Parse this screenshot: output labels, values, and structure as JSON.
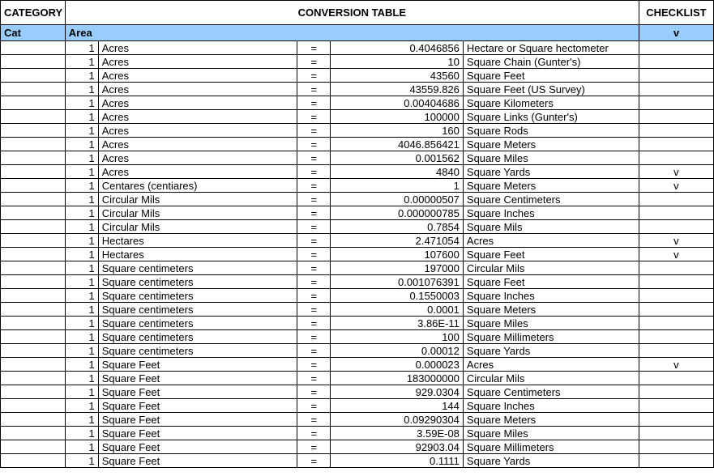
{
  "headers": {
    "category": "CATEGORY",
    "conversion_table": "CONVERSION TABLE",
    "checklist": "CHECKLIST",
    "cat": "Cat",
    "area": "Area",
    "v": "v"
  },
  "rows": [
    {
      "qty": "1",
      "unit": "Acres",
      "eq": "=",
      "val": "0.4046856",
      "result": "Hectare or Square hectometer",
      "check": ""
    },
    {
      "qty": "1",
      "unit": "Acres",
      "eq": "=",
      "val": "10",
      "result": "Square Chain (Gunter's)",
      "check": ""
    },
    {
      "qty": "1",
      "unit": "Acres",
      "eq": "=",
      "val": "43560",
      "result": "Square Feet",
      "check": ""
    },
    {
      "qty": "1",
      "unit": "Acres",
      "eq": "=",
      "val": "43559.826",
      "result": "Square Feet (US Survey)",
      "check": ""
    },
    {
      "qty": "1",
      "unit": "Acres",
      "eq": "=",
      "val": "0.00404686",
      "result": "Square Kilometers",
      "check": ""
    },
    {
      "qty": "1",
      "unit": "Acres",
      "eq": "=",
      "val": "100000",
      "result": "Square Links (Gunter's)",
      "check": ""
    },
    {
      "qty": "1",
      "unit": "Acres",
      "eq": "=",
      "val": "160",
      "result": "Square Rods",
      "check": ""
    },
    {
      "qty": "1",
      "unit": "Acres",
      "eq": "=",
      "val": "4046.856421",
      "result": "Square Meters",
      "check": ""
    },
    {
      "qty": "1",
      "unit": "Acres",
      "eq": "=",
      "val": "0.001562",
      "result": "Square Miles",
      "check": ""
    },
    {
      "qty": "1",
      "unit": "Acres",
      "eq": "=",
      "val": "4840",
      "result": "Square Yards",
      "check": "v"
    },
    {
      "qty": "1",
      "unit": "Centares (centiares)",
      "eq": "=",
      "val": "1",
      "result": "Square Meters",
      "check": "v"
    },
    {
      "qty": "1",
      "unit": "Circular Mils",
      "eq": "=",
      "val": "0.00000507",
      "result": "Square Centimeters",
      "check": ""
    },
    {
      "qty": "1",
      "unit": "Circular Mils",
      "eq": "=",
      "val": "0.000000785",
      "result": "Square Inches",
      "check": ""
    },
    {
      "qty": "1",
      "unit": "Circular Mils",
      "eq": "=",
      "val": "0.7854",
      "result": "Square Mils",
      "check": ""
    },
    {
      "qty": "1",
      "unit": "Hectares",
      "eq": "=",
      "val": "2.471054",
      "result": "Acres",
      "check": "v"
    },
    {
      "qty": "1",
      "unit": "Hectares",
      "eq": "=",
      "val": "107600",
      "result": "Square Feet",
      "check": "v"
    },
    {
      "qty": "1",
      "unit": "Square centimeters",
      "eq": "=",
      "val": "197000",
      "result": "Circular Mils",
      "check": ""
    },
    {
      "qty": "1",
      "unit": "Square centimeters",
      "eq": "=",
      "val": "0.001076391",
      "result": "Square Feet",
      "check": ""
    },
    {
      "qty": "1",
      "unit": "Square centimeters",
      "eq": "=",
      "val": "0.1550003",
      "result": "Square Inches",
      "check": ""
    },
    {
      "qty": "1",
      "unit": "Square centimeters",
      "eq": "=",
      "val": "0.0001",
      "result": "Square Meters",
      "check": ""
    },
    {
      "qty": "1",
      "unit": "Square centimeters",
      "eq": "=",
      "val": "3.86E-11",
      "result": "Square Miles",
      "check": ""
    },
    {
      "qty": "1",
      "unit": "Square centimeters",
      "eq": "=",
      "val": "100",
      "result": "Square Millimeters",
      "check": ""
    },
    {
      "qty": "1",
      "unit": "Square centimeters",
      "eq": "=",
      "val": "0.00012",
      "result": "Square Yards",
      "check": ""
    },
    {
      "qty": "1",
      "unit": "Square Feet",
      "eq": "=",
      "val": "0.000023",
      "result": "Acres",
      "check": "v"
    },
    {
      "qty": "1",
      "unit": "Square Feet",
      "eq": "=",
      "val": "183000000",
      "result": "Circular Mils",
      "check": ""
    },
    {
      "qty": "1",
      "unit": "Square Feet",
      "eq": "=",
      "val": "929.0304",
      "result": "Square Centimeters",
      "check": ""
    },
    {
      "qty": "1",
      "unit": "Square Feet",
      "eq": "=",
      "val": "144",
      "result": "Square Inches",
      "check": ""
    },
    {
      "qty": "1",
      "unit": "Square Feet",
      "eq": "=",
      "val": "0.09290304",
      "result": "Square Meters",
      "check": ""
    },
    {
      "qty": "1",
      "unit": "Square Feet",
      "eq": "=",
      "val": "3.59E-08",
      "result": "Square Miles",
      "check": ""
    },
    {
      "qty": "1",
      "unit": "Square Feet",
      "eq": "=",
      "val": "92903.04",
      "result": "Square Millimeters",
      "check": ""
    },
    {
      "qty": "1",
      "unit": "Square Feet",
      "eq": "=",
      "val": "0.1111",
      "result": "Square Yards",
      "check": ""
    }
  ]
}
